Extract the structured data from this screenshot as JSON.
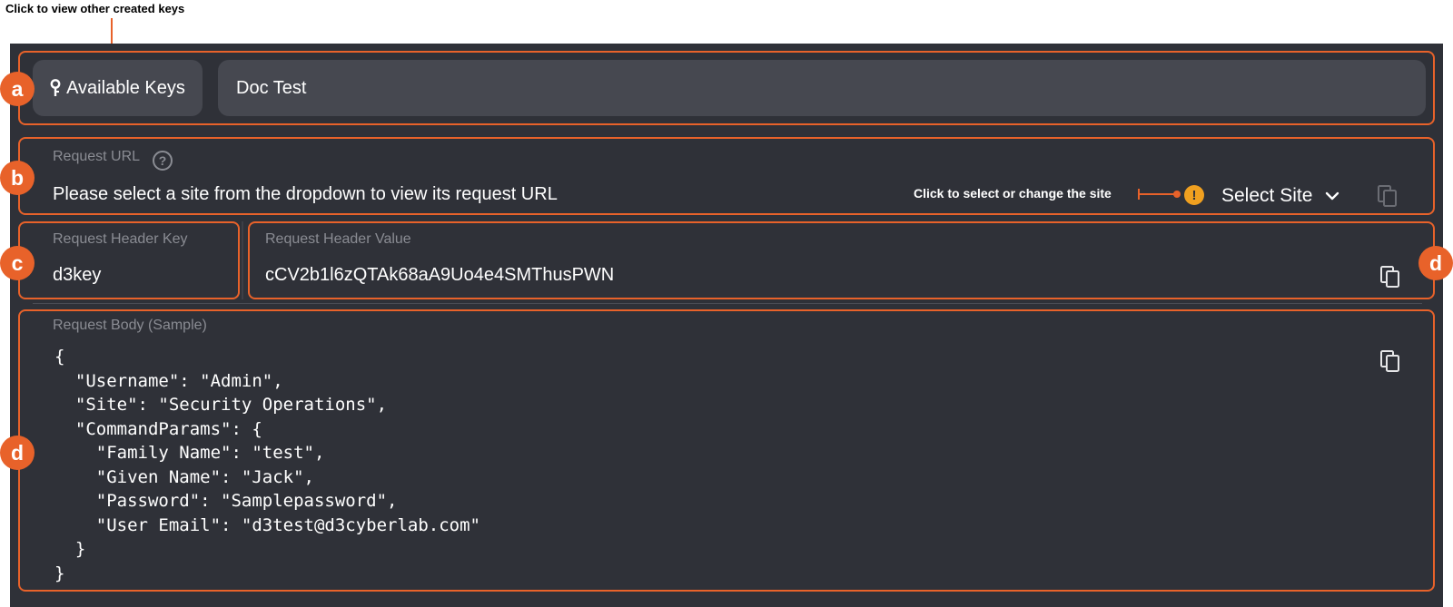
{
  "annotations": {
    "top": "Click to view other created keys",
    "site": "Click to select or change the site"
  },
  "badges": {
    "a": "a",
    "b": "b",
    "c": "c",
    "d1": "d",
    "d2": "d"
  },
  "keys": {
    "available_label": "Available Keys",
    "key_name": "Doc Test"
  },
  "request_url": {
    "label": "Request URL",
    "help_glyph": "?",
    "value": "Please select a site from the dropdown to view its request URL",
    "warning_glyph": "!",
    "select_label": "Select Site"
  },
  "header_key": {
    "label": "Request Header Key",
    "value": "d3key"
  },
  "header_value": {
    "label": "Request Header Value",
    "value": "cCV2b1l6zQTAk68aA9Uo4e4SMThusPWN"
  },
  "body": {
    "label": "Request Body (Sample)",
    "code": "{\n  \"Username\": \"Admin\",\n  \"Site\": \"Security Operations\",\n  \"CommandParams\": {\n    \"Family Name\": \"test\",\n    \"Given Name\": \"Jack\",\n    \"Password\": \"Samplepassword\",\n    \"User Email\": \"d3test@d3cyberlab.com\"\n  }\n}"
  },
  "colors": {
    "accent": "#e8622a",
    "panel": "#2f3138",
    "field": "#464850",
    "warning": "#f0a020"
  },
  "icons": {
    "key": "key-icon",
    "help": "help-circle-icon",
    "warning": "warning-icon",
    "chevron": "chevron-down-icon",
    "copy": "copy-icon"
  }
}
